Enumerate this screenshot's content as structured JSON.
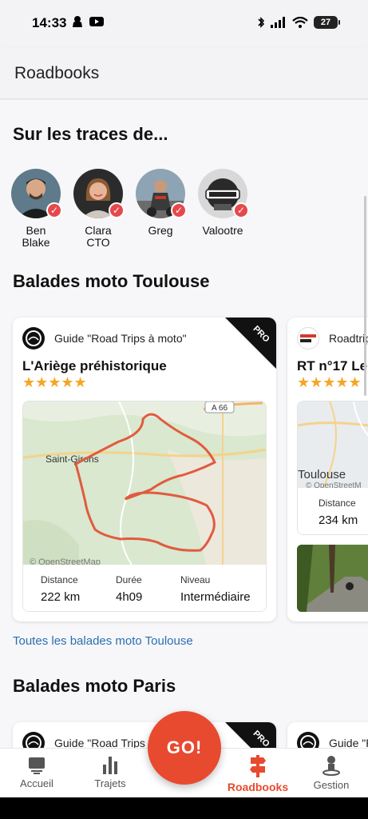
{
  "status": {
    "time": "14:33",
    "battery": "27"
  },
  "header": {
    "title": "Roadbooks"
  },
  "section_people": {
    "title": "Sur les traces de...",
    "people": [
      {
        "name": "Ben Blake"
      },
      {
        "name": "Clara\nCTO"
      },
      {
        "name": "Greg"
      },
      {
        "name": "Valootre"
      }
    ]
  },
  "section_toulouse": {
    "title": "Balades moto Toulouse",
    "card1": {
      "guide": "Guide \"Road Trips à moto\"",
      "badge": "PRO",
      "title": "L'Ariège préhistorique",
      "stars": "★★★★★",
      "map": {
        "town": "Saint-Girons",
        "road": "A 66",
        "attribution": "© OpenStreetMap"
      },
      "stats": {
        "distance_label": "Distance",
        "distance": "222 km",
        "duration_label": "Durée",
        "duration": "4h09",
        "level_label": "Niveau",
        "level": "Intermédiaire"
      }
    },
    "card2": {
      "guide": "Roadtrip",
      "title": "RT n°17 Le T",
      "stars": "★★★★★",
      "map": {
        "town": "Toulouse",
        "attribution": "© OpenStreetM"
      },
      "stats": {
        "distance_label": "Distance",
        "distance": "234 km"
      }
    },
    "link_all": "Toutes les balades moto Toulouse"
  },
  "section_paris": {
    "title": "Balades moto Paris",
    "card1": {
      "guide": "Guide \"Road Trips à",
      "badge": "PRO"
    },
    "card2": {
      "guide": "Guide \"F"
    }
  },
  "nav": {
    "go": "GO!",
    "items": [
      {
        "label": "Accueil"
      },
      {
        "label": "Trajets"
      },
      {
        "label": "Roadbooks"
      },
      {
        "label": "Gestion"
      }
    ]
  },
  "colors": {
    "accent": "#e84a2f",
    "link": "#2a6fb0",
    "star": "#f5a623",
    "verified": "#e5484d"
  }
}
